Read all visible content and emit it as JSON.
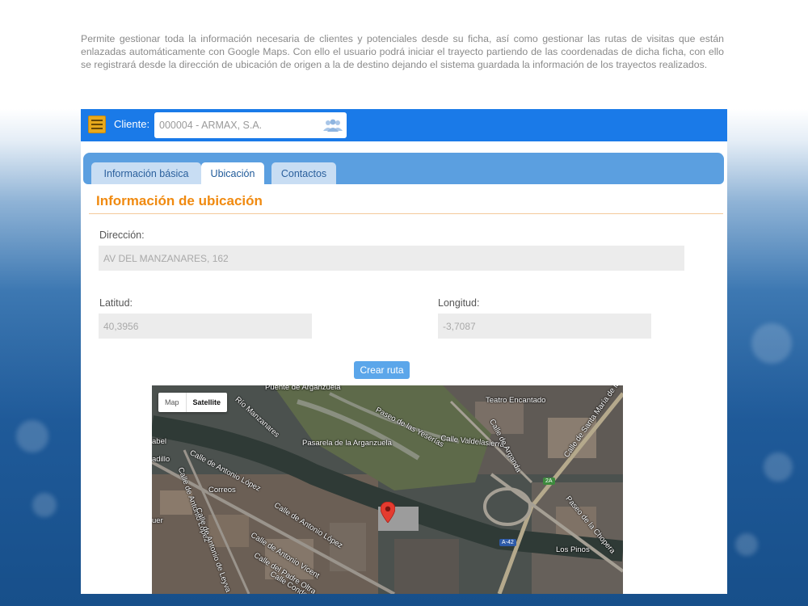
{
  "intro_text": "Permite gestionar toda la información necesaria de clientes y potenciales desde su ficha, así como gestionar las rutas de visitas que están enlazadas automáticamente con Google Maps. Con ello el usuario podrá iniciar el trayecto partiendo de las coordenadas de dicha ficha, con ello se registrará desde la dirección de ubicación de origen a la de destino dejando el sistema guardada la información de los trayectos realizados.",
  "topbar": {
    "client_label": "Cliente:",
    "client_value": "000004 - ARMAX, S.A.",
    "menu_icon": "hamburger-icon",
    "users_icon": "users-icon",
    "bar_color": "#1a7ae8",
    "menu_color": "#e8a91c"
  },
  "tabs": [
    {
      "label": "Información básica",
      "active": false
    },
    {
      "label": "Ubicación",
      "active": true
    },
    {
      "label": "Contactos",
      "active": false
    }
  ],
  "section_title": "Información de ubicación",
  "accent_color": "#f08a10",
  "fields": {
    "direccion": {
      "label": "Dirección:",
      "value": "AV DEL MANZANARES, 162"
    },
    "latitud": {
      "label": "Latitud:",
      "value": "40,3956"
    },
    "longitud": {
      "label": "Longitud:",
      "value": "-3,7087"
    }
  },
  "route_button": "Crear ruta",
  "map": {
    "type_options": {
      "map": "Map",
      "satellite": "Satellite"
    },
    "selected_type": "Satellite",
    "labels": {
      "puente": "Puente de Arganzuela",
      "rio": "Río Manzanares",
      "yeserias": "Paseo de las Yeserías",
      "pasarela": "Pasarela de la Arganzuela",
      "teatro": "Teatro Encantado",
      "valdelasierra": "Calle Valdelasierra",
      "arganda": "Calle de Arganda",
      "santa_maria": "Calle de Santa María de la Cabeza",
      "antonio_lopez_1": "Calle de Antonio López",
      "antonio_lopez_2": "Calle de Antonio López",
      "antonio_lopez_3": "Calle de Antonio López",
      "antonio_leyva": "Calle de Antonio de Leyva",
      "antonio_vicent": "Calle de Antonio Vicent",
      "padre_oltra": "Calle del Padre Oltra",
      "conde_vistahermosa": "Calle Conde de Vistahermosa",
      "chopera": "Paseo de la Chopera",
      "correos": "Correos",
      "los_pinos": "Los Pinos",
      "abel": "abel",
      "adillo": "adillo",
      "uer": "uer",
      "a42": "A-42",
      "r2a": "2A"
    }
  }
}
